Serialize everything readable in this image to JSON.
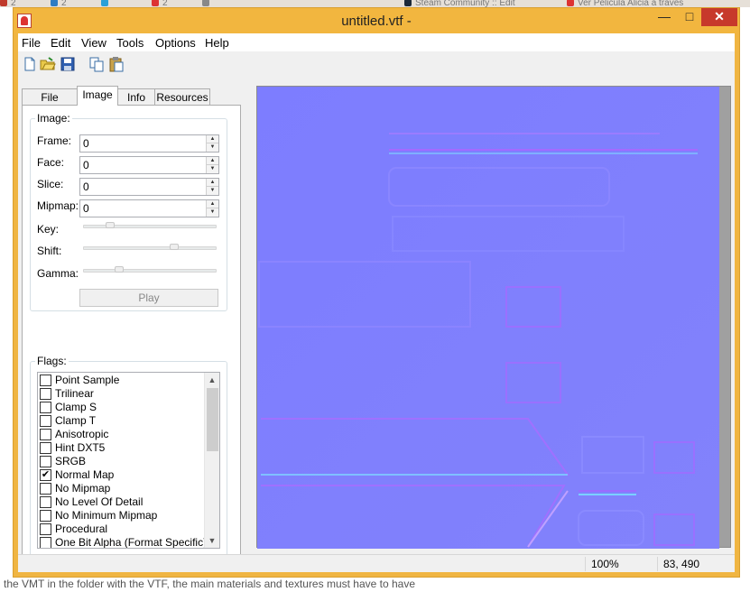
{
  "background": {
    "tabs": [
      {
        "label": "2",
        "color": "#c0392b"
      },
      {
        "label": "2",
        "color": "#2e7cc4"
      },
      {
        "label": "",
        "color": "#2aa0d8"
      },
      {
        "label": "2",
        "color": "#d33"
      },
      {
        "label": "",
        "color": "#888"
      },
      {
        "label": "Steam Community :: Edit",
        "color": "#1b2838"
      },
      {
        "label": "Ver Pelicula Alicia a través",
        "color": "#d33"
      }
    ],
    "bottom_text": "the VMT in the folder with the VTF, the main materials and textures must have to have"
  },
  "window": {
    "title": "untitled.vtf -",
    "minimize": "—",
    "maximize": "□",
    "close": "✕"
  },
  "menu": [
    "File",
    "Edit",
    "View",
    "Tools",
    "Options",
    "Help"
  ],
  "toolbar": [
    {
      "icon": "new-file-icon"
    },
    {
      "icon": "open-folder-icon"
    },
    {
      "icon": "save-icon"
    },
    {
      "icon": "copy-icon"
    },
    {
      "icon": "paste-icon"
    }
  ],
  "tabs": [
    "File System",
    "Image",
    "Info",
    "Resources"
  ],
  "active_tab": "Image",
  "image_group": {
    "label": "Image:",
    "frame_label": "Frame:",
    "frame_value": "0",
    "face_label": "Face:",
    "face_value": "0",
    "slice_label": "Slice:",
    "slice_value": "0",
    "mipmap_label": "Mipmap:",
    "mipmap_value": "0",
    "key_label": "Key:",
    "key_level": 0.18,
    "shift_label": "Shift:",
    "shift_level": 0.7,
    "gamma_label": "Gamma:",
    "gamma_level": 0.25,
    "play_label": "Play"
  },
  "flags_group": {
    "label": "Flags:",
    "items": [
      {
        "label": "Point Sample",
        "checked": false
      },
      {
        "label": "Trilinear",
        "checked": false
      },
      {
        "label": "Clamp S",
        "checked": false
      },
      {
        "label": "Clamp T",
        "checked": false
      },
      {
        "label": "Anisotropic",
        "checked": false
      },
      {
        "label": "Hint DXT5",
        "checked": false
      },
      {
        "label": "SRGB",
        "checked": false
      },
      {
        "label": "Normal Map",
        "checked": true
      },
      {
        "label": "No Mipmap",
        "checked": false
      },
      {
        "label": "No Level Of Detail",
        "checked": false
      },
      {
        "label": "No Minimum Mipmap",
        "checked": false
      },
      {
        "label": "Procedural",
        "checked": false
      },
      {
        "label": "One Bit Alpha (Format Specific)",
        "checked": false
      }
    ]
  },
  "status": {
    "zoom": "100%",
    "coords": "83, 490"
  },
  "colors": {
    "titlebar": "#f2b63f",
    "close": "#c7392b",
    "normal_map_base": "#8080ff",
    "viewer_bg": "#a0a0a0"
  }
}
